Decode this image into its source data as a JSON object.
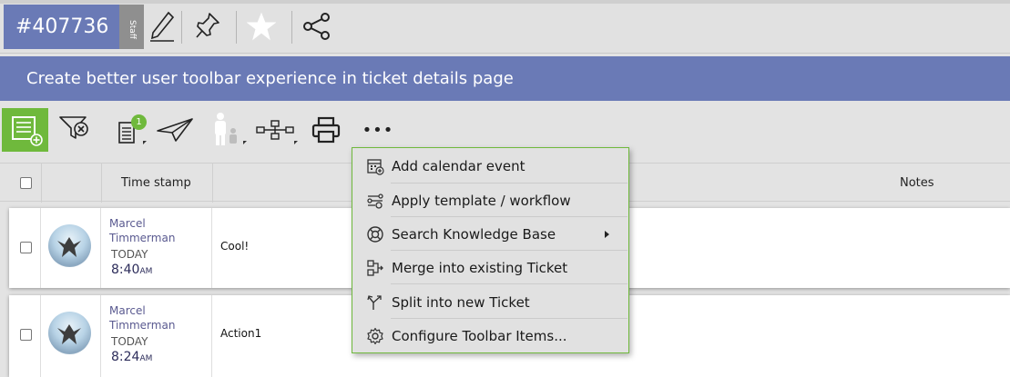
{
  "header": {
    "ticket_id": "#407736",
    "staff_tag": "Staff",
    "icons": [
      "edit-icon",
      "pin-icon",
      "star-icon",
      "share-icon"
    ]
  },
  "title": "Create better user toolbar experience in ticket details page",
  "toolbar": {
    "icons": [
      "add-note-icon",
      "filter-clear-icon",
      "notes-list-icon",
      "send-icon",
      "people-icon",
      "workflow-icon",
      "print-icon",
      "more-icon"
    ],
    "notes_badge": "1",
    "more_label": "•••"
  },
  "grid": {
    "columns": {
      "timestamp": "Time stamp",
      "notes": "Notes"
    },
    "rows": [
      {
        "author_first": "Marcel",
        "author_last": "Timmerman",
        "day": "TODAY",
        "time": "8:40",
        "ampm": "AM",
        "note": "Cool!"
      },
      {
        "author_first": "Marcel",
        "author_last": "Timmerman",
        "day": "TODAY",
        "time": "8:24",
        "ampm": "AM",
        "note": "Action1"
      }
    ]
  },
  "menu": {
    "items": [
      {
        "label": "Add calendar event",
        "icon": "calendar-add-icon"
      },
      {
        "label": "Apply template / workflow",
        "icon": "template-workflow-icon"
      },
      {
        "label": "Search Knowledge Base",
        "icon": "lifebuoy-icon",
        "has_submenu": true
      },
      {
        "label": "Merge into existing Ticket",
        "icon": "merge-icon"
      },
      {
        "label": "Split into new Ticket",
        "icon": "split-icon"
      },
      {
        "label": "Configure Toolbar Items...",
        "icon": "gear-icon"
      }
    ]
  },
  "colors": {
    "brand": "#6a7ab6",
    "accent_green": "#6fb93c",
    "staff_gray": "#8f8f8f"
  }
}
